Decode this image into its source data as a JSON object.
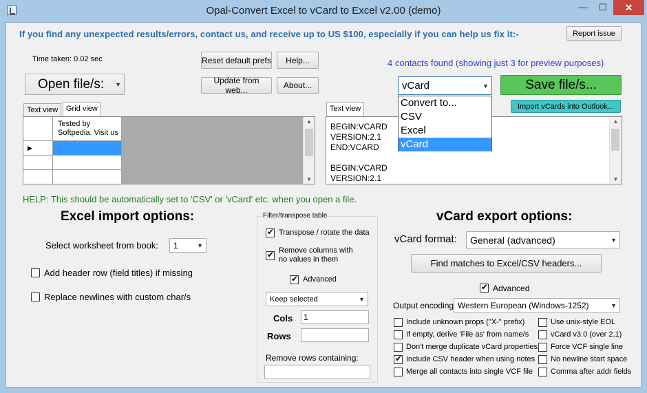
{
  "window": {
    "title": "Opal-Convert Excel to vCard to Excel v2.00 (demo)",
    "minimize": "—",
    "maximize": "☐",
    "close": "✕"
  },
  "header": {
    "notice": "If you find any unexpected results/errors, contact us, and receive up to US $100, especially if you can help us fix it:-",
    "report_issue": "Report issue",
    "time_taken": "Time taken: 0.02 sec",
    "reset_prefs": "Reset default prefs",
    "help": "Help...",
    "update_web": "Update from web...",
    "about": "About...",
    "open_files": "Open file/s:",
    "contacts_found": "4 contacts found (showing just 3 for preview purposes)",
    "format_select": "vCard",
    "save_files": "Save file/s...",
    "import_outlook": "Import vCards into Outlook..."
  },
  "format_options": [
    "Convert to...",
    "CSV",
    "Excel",
    "vCard"
  ],
  "left_tabs": [
    "Text view",
    "Grid view"
  ],
  "grid": {
    "header_cell": "Tested by Softpedia. Visit us",
    "row_marker": "▶"
  },
  "right_tab": "Text view",
  "text_preview": [
    "BEGIN:VCARD",
    "VERSION:2.1",
    "END:VCARD",
    "",
    "BEGIN:VCARD",
    "VERSION:2.1"
  ],
  "help_text": "HELP: This should be automatically set to 'CSV' or 'vCard' etc. when you open a file.",
  "excel_import": {
    "title": "Excel import options:",
    "worksheet_label": "Select worksheet from book:",
    "worksheet_value": "1",
    "add_header": "Add header row (field titles) if missing",
    "replace_newlines": "Replace newlines with custom char/s"
  },
  "filter": {
    "title": "Filter/transpose table",
    "transpose": "Transpose / rotate the data",
    "remove_empty": "Remove columns with no values in them",
    "advanced": "Advanced",
    "keep_selected": "Keep selected",
    "cols_label": "Cols",
    "cols_value": "1",
    "rows_label": "Rows",
    "rows_value": "",
    "remove_rows": "Remove rows containing:"
  },
  "vcard_export": {
    "title": "vCard export options:",
    "format_label": "vCard format:",
    "format_value": "General (advanced)",
    "find_matches": "Find matches to Excel/CSV headers...",
    "advanced": "Advanced",
    "encoding_label": "Output encoding:",
    "encoding_value": "Western European (Windows-1252)",
    "options_left": [
      {
        "label": "Include unknown props (\"X-\" prefix)",
        "checked": false
      },
      {
        "label": "If empty, derive 'File as' from name/s",
        "checked": false
      },
      {
        "label": "Don't merge duplicate vCard properties",
        "checked": false
      },
      {
        "label": "Include CSV header when using notes",
        "checked": true
      },
      {
        "label": "Merge all contacts into single VCF file",
        "checked": false
      }
    ],
    "options_right": [
      {
        "label": "Use unix-style EOL",
        "checked": false
      },
      {
        "label": "vCard v3.0 (over 2.1)",
        "checked": false
      },
      {
        "label": "Force VCF single line",
        "checked": false
      },
      {
        "label": "No newline start space",
        "checked": false
      },
      {
        "label": "Comma after addr fields",
        "checked": false
      }
    ]
  },
  "colors": {
    "titlebar": "#a7c9e6",
    "notice_blue": "#2a6bb0",
    "found_blue": "#2b3fd1",
    "save_green": "#58c658",
    "import_teal": "#40c8c8",
    "help_green": "#1f7a1f",
    "selection": "#3399ff"
  }
}
